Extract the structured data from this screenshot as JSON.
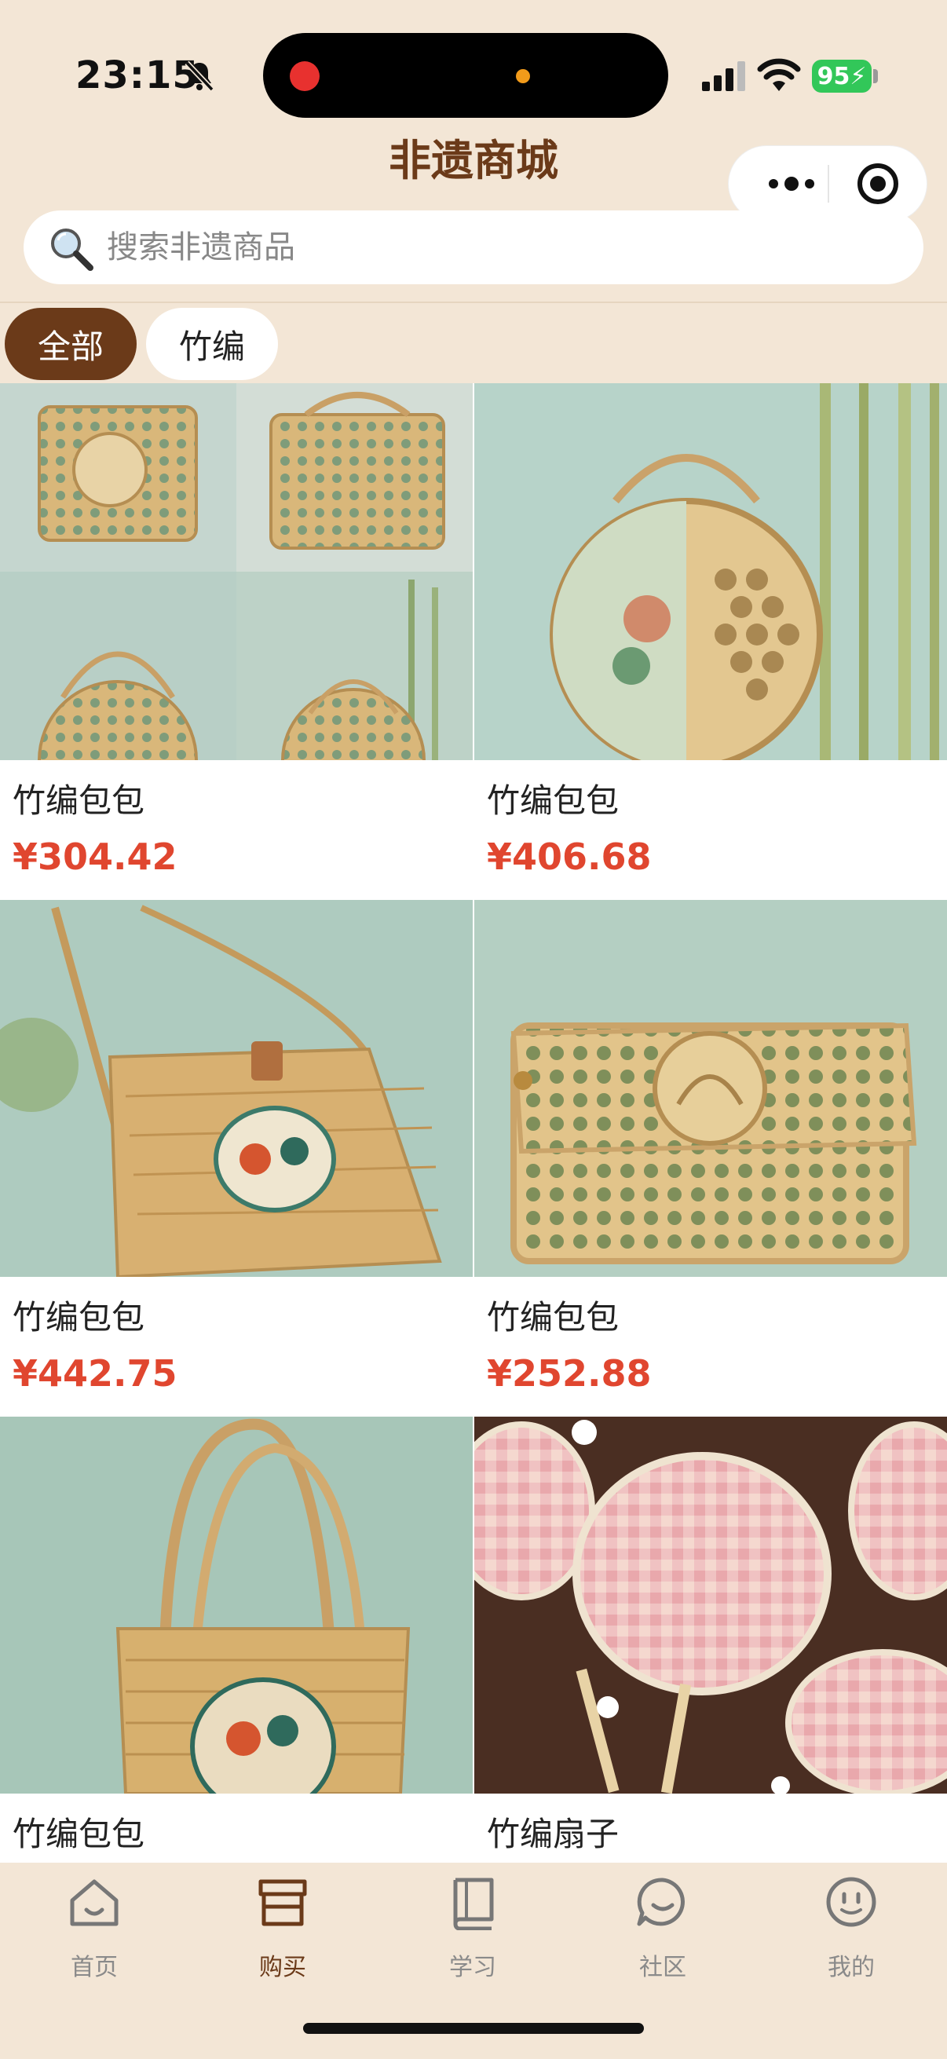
{
  "status": {
    "time": "23:15",
    "battery": "95"
  },
  "header": {
    "title": "非遗商城"
  },
  "search": {
    "placeholder": "搜索非遗商品"
  },
  "categories": [
    {
      "label": "全部",
      "active": true
    },
    {
      "label": "竹编",
      "active": false
    }
  ],
  "products": [
    {
      "name": "竹编包包",
      "price": "¥304.42"
    },
    {
      "name": "竹编包包",
      "price": "¥406.68"
    },
    {
      "name": "竹编包包",
      "price": "¥442.75"
    },
    {
      "name": "竹编包包",
      "price": "¥252.88"
    },
    {
      "name": "竹编包包",
      "price": ""
    },
    {
      "name": "竹编扇子",
      "price": ""
    }
  ],
  "tabbar": [
    {
      "label": "首页",
      "icon": "home-icon"
    },
    {
      "label": "购买",
      "icon": "shop-icon",
      "active": true
    },
    {
      "label": "学习",
      "icon": "book-icon"
    },
    {
      "label": "社区",
      "icon": "chat-icon"
    },
    {
      "label": "我的",
      "icon": "smile-icon"
    }
  ],
  "colors": {
    "brand": "#6b3a19",
    "price": "#e0462f",
    "background": "#f3e6d6",
    "battery": "#32c759"
  }
}
